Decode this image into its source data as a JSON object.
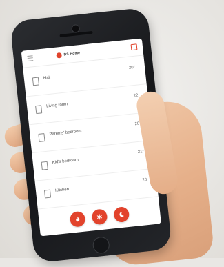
{
  "app": {
    "logo_text": "DS Home",
    "menu_icon": "hamburger-menu-icon",
    "edit_icon": "edit-icon"
  },
  "rooms": [
    {
      "name": "Hall",
      "temp": "20°"
    },
    {
      "name": "Living room",
      "temp": "22"
    },
    {
      "name": "Parents' bedroom",
      "temp": "20°"
    },
    {
      "name": "Kid's bedroom",
      "temp": "21°"
    },
    {
      "name": "Kitchen",
      "temp": "20"
    }
  ],
  "actions": [
    {
      "icon": "flame-icon"
    },
    {
      "icon": "snowflake-icon"
    },
    {
      "icon": "moon-icon"
    }
  ],
  "colors": {
    "accent": "#e2432c",
    "phone_body": "#1f2024",
    "background": "#e9e7e4"
  }
}
